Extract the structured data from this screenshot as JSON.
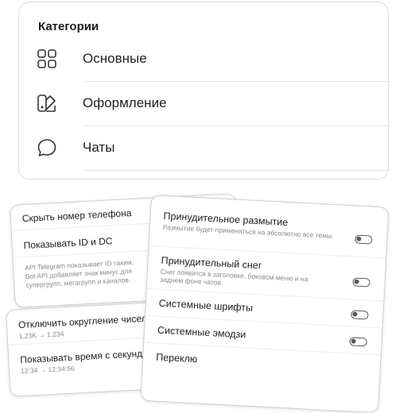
{
  "categories": {
    "title": "Категории",
    "items": [
      {
        "label": "Основные",
        "icon": "grid-icon"
      },
      {
        "label": "Оформление",
        "icon": "palette-icon"
      },
      {
        "label": "Чаты",
        "icon": "chat-bubble-icon"
      }
    ]
  },
  "card_left_top": {
    "row1": "Скрыть номер телефона",
    "row2": "Показывать ID и DC",
    "note_line1": "API Telegram показывает ID таким,",
    "note_line2": "Bot API добавляет знак минус для",
    "note_line3": "супергрупп, мегагрупп и каналов."
  },
  "card_left_bottom": {
    "row1_title": "Отключить округление чисел",
    "row1_sub": "1,23K → 1,234",
    "row2_title": "Показывать время с секунд",
    "row2_sub": "12:34 → 12:34:56"
  },
  "card_right": {
    "rows": [
      {
        "title": "Принудительное размытие",
        "sub": "Размытие будет применяться на абсолютно все темы."
      },
      {
        "title": "Принудительный снег",
        "sub": "Снег появится в заголовке, боковом меню и на заднем фоне чатов."
      },
      {
        "title": "Системные шрифты",
        "sub": ""
      },
      {
        "title": "Системные эмодзи",
        "sub": ""
      },
      {
        "title": "Переклю",
        "sub": ""
      }
    ]
  }
}
